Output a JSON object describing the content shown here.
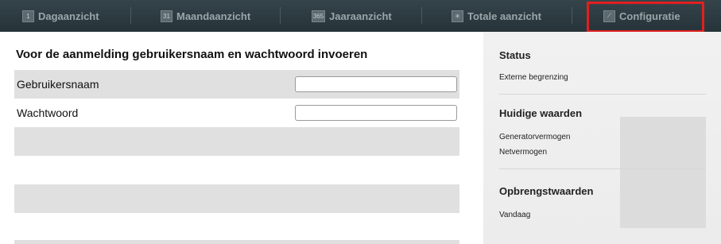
{
  "nav": {
    "items": [
      {
        "icon": "1",
        "label": "Dagaanzicht"
      },
      {
        "icon": "31",
        "label": "Maandaanzicht"
      },
      {
        "icon": "365",
        "label": "Jaaraanzicht"
      },
      {
        "icon": "✳",
        "label": "Totale aanzicht"
      },
      {
        "icon": "⟋",
        "label": "Configuratie"
      }
    ],
    "highlight_color": "#e02020"
  },
  "login": {
    "title": "Voor de aanmelding gebruikersnaam en wachtwoord invoeren",
    "username_label": "Gebruikersnaam",
    "username_value": "",
    "password_label": "Wachtwoord",
    "password_value": ""
  },
  "sidebar": {
    "status_heading": "Status",
    "status_item": "Externe begrenzing",
    "current_heading": "Huidige waarden",
    "current_items": [
      "Generatorvermogen",
      "Netvermogen"
    ],
    "yield_heading": "Opbrengstwaarden",
    "yield_items": [
      "Vandaag"
    ]
  },
  "colors": {
    "nav_bg": "#2b3a40",
    "row_shade": "#e0e0e0",
    "sidebar_bg": "#eeeeee"
  }
}
